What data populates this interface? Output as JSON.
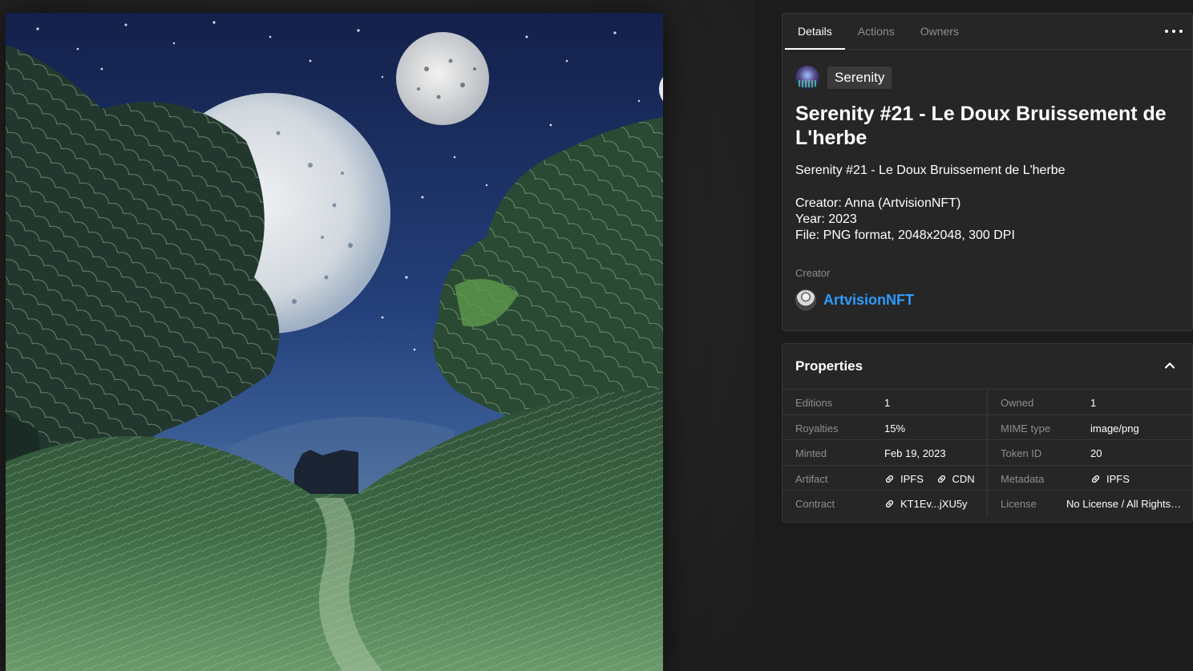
{
  "tabs": [
    {
      "label": "Details",
      "active": true
    },
    {
      "label": "Actions",
      "active": false
    },
    {
      "label": "Owners",
      "active": false
    }
  ],
  "more_icon": "more-horizontal-icon",
  "collection": {
    "name": "Serenity",
    "avatar_icon": "collection-avatar"
  },
  "nft": {
    "title": "Serenity #21 - Le Doux Bruissement de L'herbe",
    "description": {
      "line1": "Serenity #21 - Le Doux Bruissement de L'herbe",
      "creator": "Creator: Anna (ArtvisionNFT)",
      "year": "Year: 2023",
      "file": "File: PNG format, 2048x2048, 300 DPI"
    }
  },
  "creator": {
    "label": "Creator",
    "name": "ArtvisionNFT",
    "name_color": "#2e9bff"
  },
  "properties": {
    "title": "Properties",
    "toggle_icon": "chevron-up-icon",
    "rows": [
      {
        "l1": "Editions",
        "v1": "1",
        "l2": "Owned",
        "v2": "1"
      },
      {
        "l1": "Royalties",
        "v1": "15%",
        "l2": "MIME type",
        "v2": "image/png"
      },
      {
        "l1": "Minted",
        "v1": "Feb 19, 2023",
        "l2": "Token ID",
        "v2": "20"
      },
      {
        "l1": "Artifact",
        "links1": [
          "IPFS",
          "CDN"
        ],
        "l2": "Metadata",
        "links2": [
          "IPFS"
        ]
      },
      {
        "l1": "Contract",
        "links1": [
          "KT1Ev...jXU5y"
        ],
        "l2": "License",
        "v2": "No License / All Rights Reserved"
      }
    ]
  },
  "artwork": {
    "description_icon": "artwork-image",
    "accent_colors": {
      "sky": "#1d3566",
      "grass": "#2f5a35",
      "moon": "#d9dee4"
    }
  }
}
